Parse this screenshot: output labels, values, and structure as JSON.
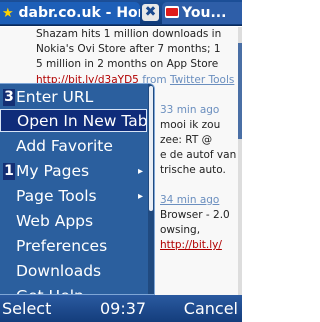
{
  "tabs": [
    {
      "title": "dabr.co.uk - Home"
    },
    {
      "title": "You..."
    }
  ],
  "page": {
    "tweet1_lines": [
      "Shazam hits 1 million downloads in",
      "Nokia's Ovi Store after 7 months; 1",
      "5 million in 2 months on App Store"
    ],
    "tweet1_link": "http://bit.ly/d3aYD5",
    "tweet1_via": "from",
    "tweet1_source": "Twitter Tools",
    "tweet2_time": "33 min ago",
    "tweet2_lines": [
      "mooi ik zou",
      "zee: RT @",
      "e de autof van",
      "trische auto."
    ],
    "tweet3_time": "34 min ago",
    "tweet3_lines": [
      "Browser - 2.0",
      "owsing,"
    ],
    "tweet3_link": "http://bit.ly/"
  },
  "menu": {
    "items": [
      {
        "label": "Enter URL",
        "badge": "3"
      },
      {
        "label": "Open In New Tab",
        "selected": true
      },
      {
        "label": "Add Favorite"
      },
      {
        "label": "My Pages",
        "badge": "1",
        "submenu": true
      },
      {
        "label": "Page Tools",
        "submenu": true
      },
      {
        "label": "Web Apps"
      },
      {
        "label": "Preferences"
      },
      {
        "label": "Downloads"
      },
      {
        "label": "Get Help"
      }
    ]
  },
  "softkeys": {
    "left": "Select",
    "clock": "09:37",
    "right": "Cancel"
  },
  "colors": {
    "menu_bg": "#2b5f9e",
    "menu_selected": "#0f2c7a",
    "link": "#b00000",
    "tabbar": "#1c4f98"
  },
  "icons": [
    "star-icon",
    "close-icon",
    "youtube-icon",
    "chevron-right-icon"
  ]
}
